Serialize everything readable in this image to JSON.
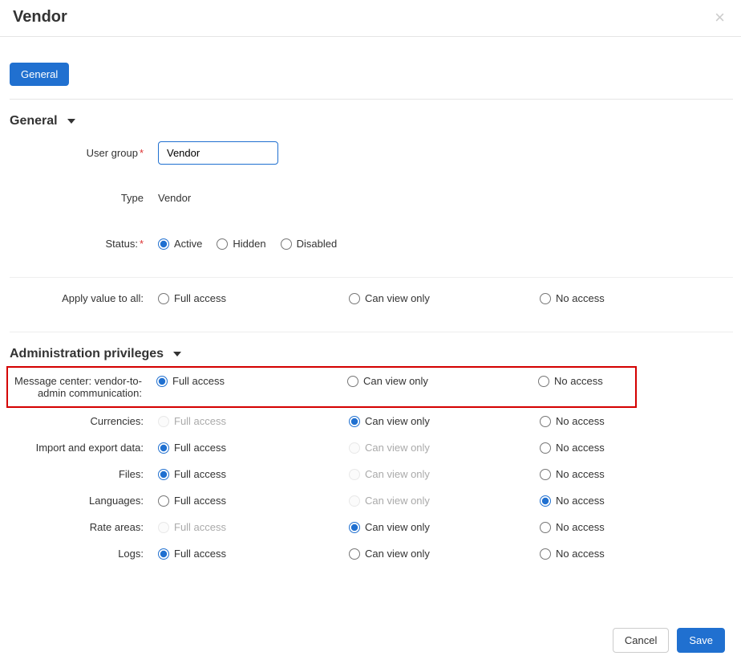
{
  "header": {
    "title": "Vendor"
  },
  "tabs": {
    "active": "General"
  },
  "sections": {
    "general_title": "General",
    "admin_priv_title": "Administration privileges"
  },
  "labels": {
    "user_group": "User group",
    "type": "Type",
    "status": "Status:",
    "apply_all": "Apply value to all:",
    "full": "Full access",
    "view": "Can view only",
    "none": "No access",
    "active": "Active",
    "hidden": "Hidden",
    "disabled": "Disabled"
  },
  "values": {
    "user_group": "Vendor",
    "type": "Vendor",
    "status": "active"
  },
  "privileges": [
    {
      "key": "msgcenter",
      "label": "Message center: vendor-to-admin communication:",
      "full": true,
      "view": false,
      "none": false,
      "full_disabled": false,
      "view_disabled": false,
      "highlight": true
    },
    {
      "key": "currencies",
      "label": "Currencies:",
      "full": false,
      "view": true,
      "none": false,
      "full_disabled": true,
      "view_disabled": false
    },
    {
      "key": "importexp",
      "label": "Import and export data:",
      "full": true,
      "view": false,
      "none": false,
      "full_disabled": false,
      "view_disabled": true
    },
    {
      "key": "files",
      "label": "Files:",
      "full": true,
      "view": false,
      "none": false,
      "full_disabled": false,
      "view_disabled": true
    },
    {
      "key": "languages",
      "label": "Languages:",
      "full": false,
      "view": false,
      "none": true,
      "full_disabled": false,
      "view_disabled": true
    },
    {
      "key": "rateareas",
      "label": "Rate areas:",
      "full": false,
      "view": true,
      "none": false,
      "full_disabled": true,
      "view_disabled": false
    },
    {
      "key": "logs",
      "label": "Logs:",
      "full": true,
      "view": false,
      "none": false,
      "full_disabled": false,
      "view_disabled": false
    }
  ],
  "footer": {
    "cancel": "Cancel",
    "save": "Save"
  }
}
